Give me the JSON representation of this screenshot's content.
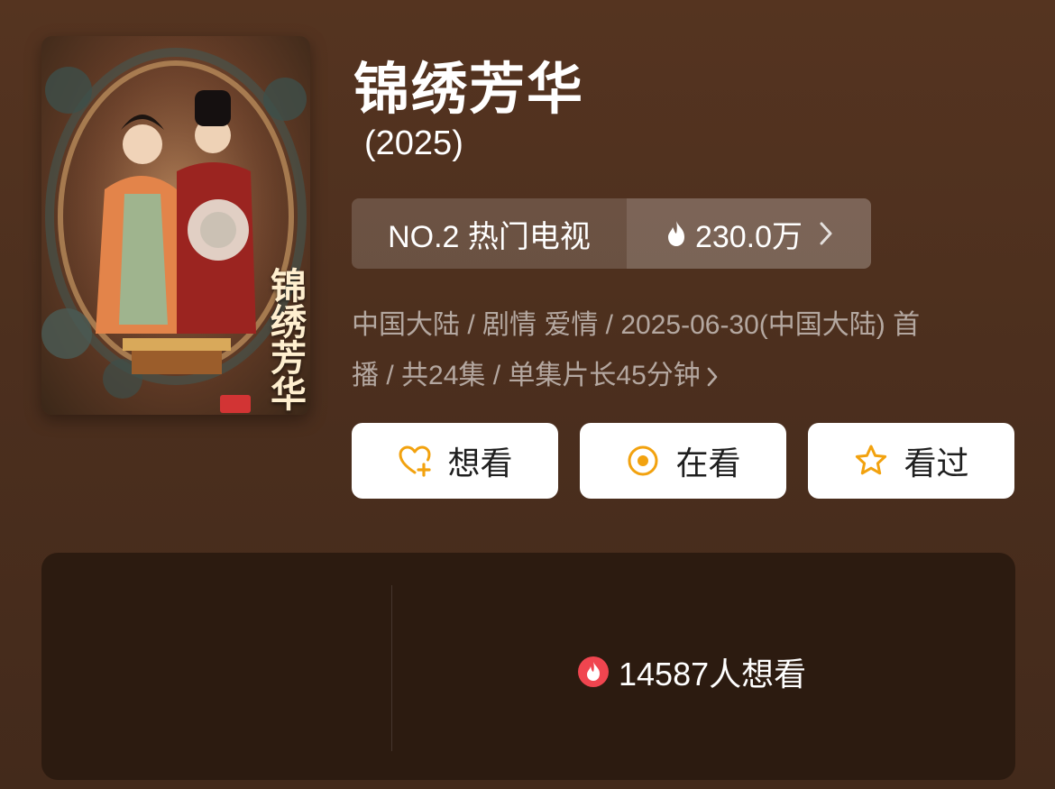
{
  "show": {
    "title": "锦绣芳华",
    "year": "(2025)",
    "poster_title": "锦绣芳华"
  },
  "rank": {
    "label": "NO.2 热门电视",
    "heat": "230.0万",
    "icon": "flame-icon"
  },
  "meta": {
    "line1": "中国大陆 / 剧情 爱情 / 2025-06-30(中国大陆) 首",
    "line2": "播 / 共24集 / 单集片长45分钟"
  },
  "actions": [
    {
      "label": "想看",
      "icon": "heart-plus-icon"
    },
    {
      "label": "在看",
      "icon": "target-icon"
    },
    {
      "label": "看过",
      "icon": "star-icon"
    }
  ],
  "stats": {
    "want_count": "14587人想看"
  },
  "colors": {
    "accent": "#f2a20f",
    "badge_red": "#f0454f",
    "background": "#553420"
  }
}
